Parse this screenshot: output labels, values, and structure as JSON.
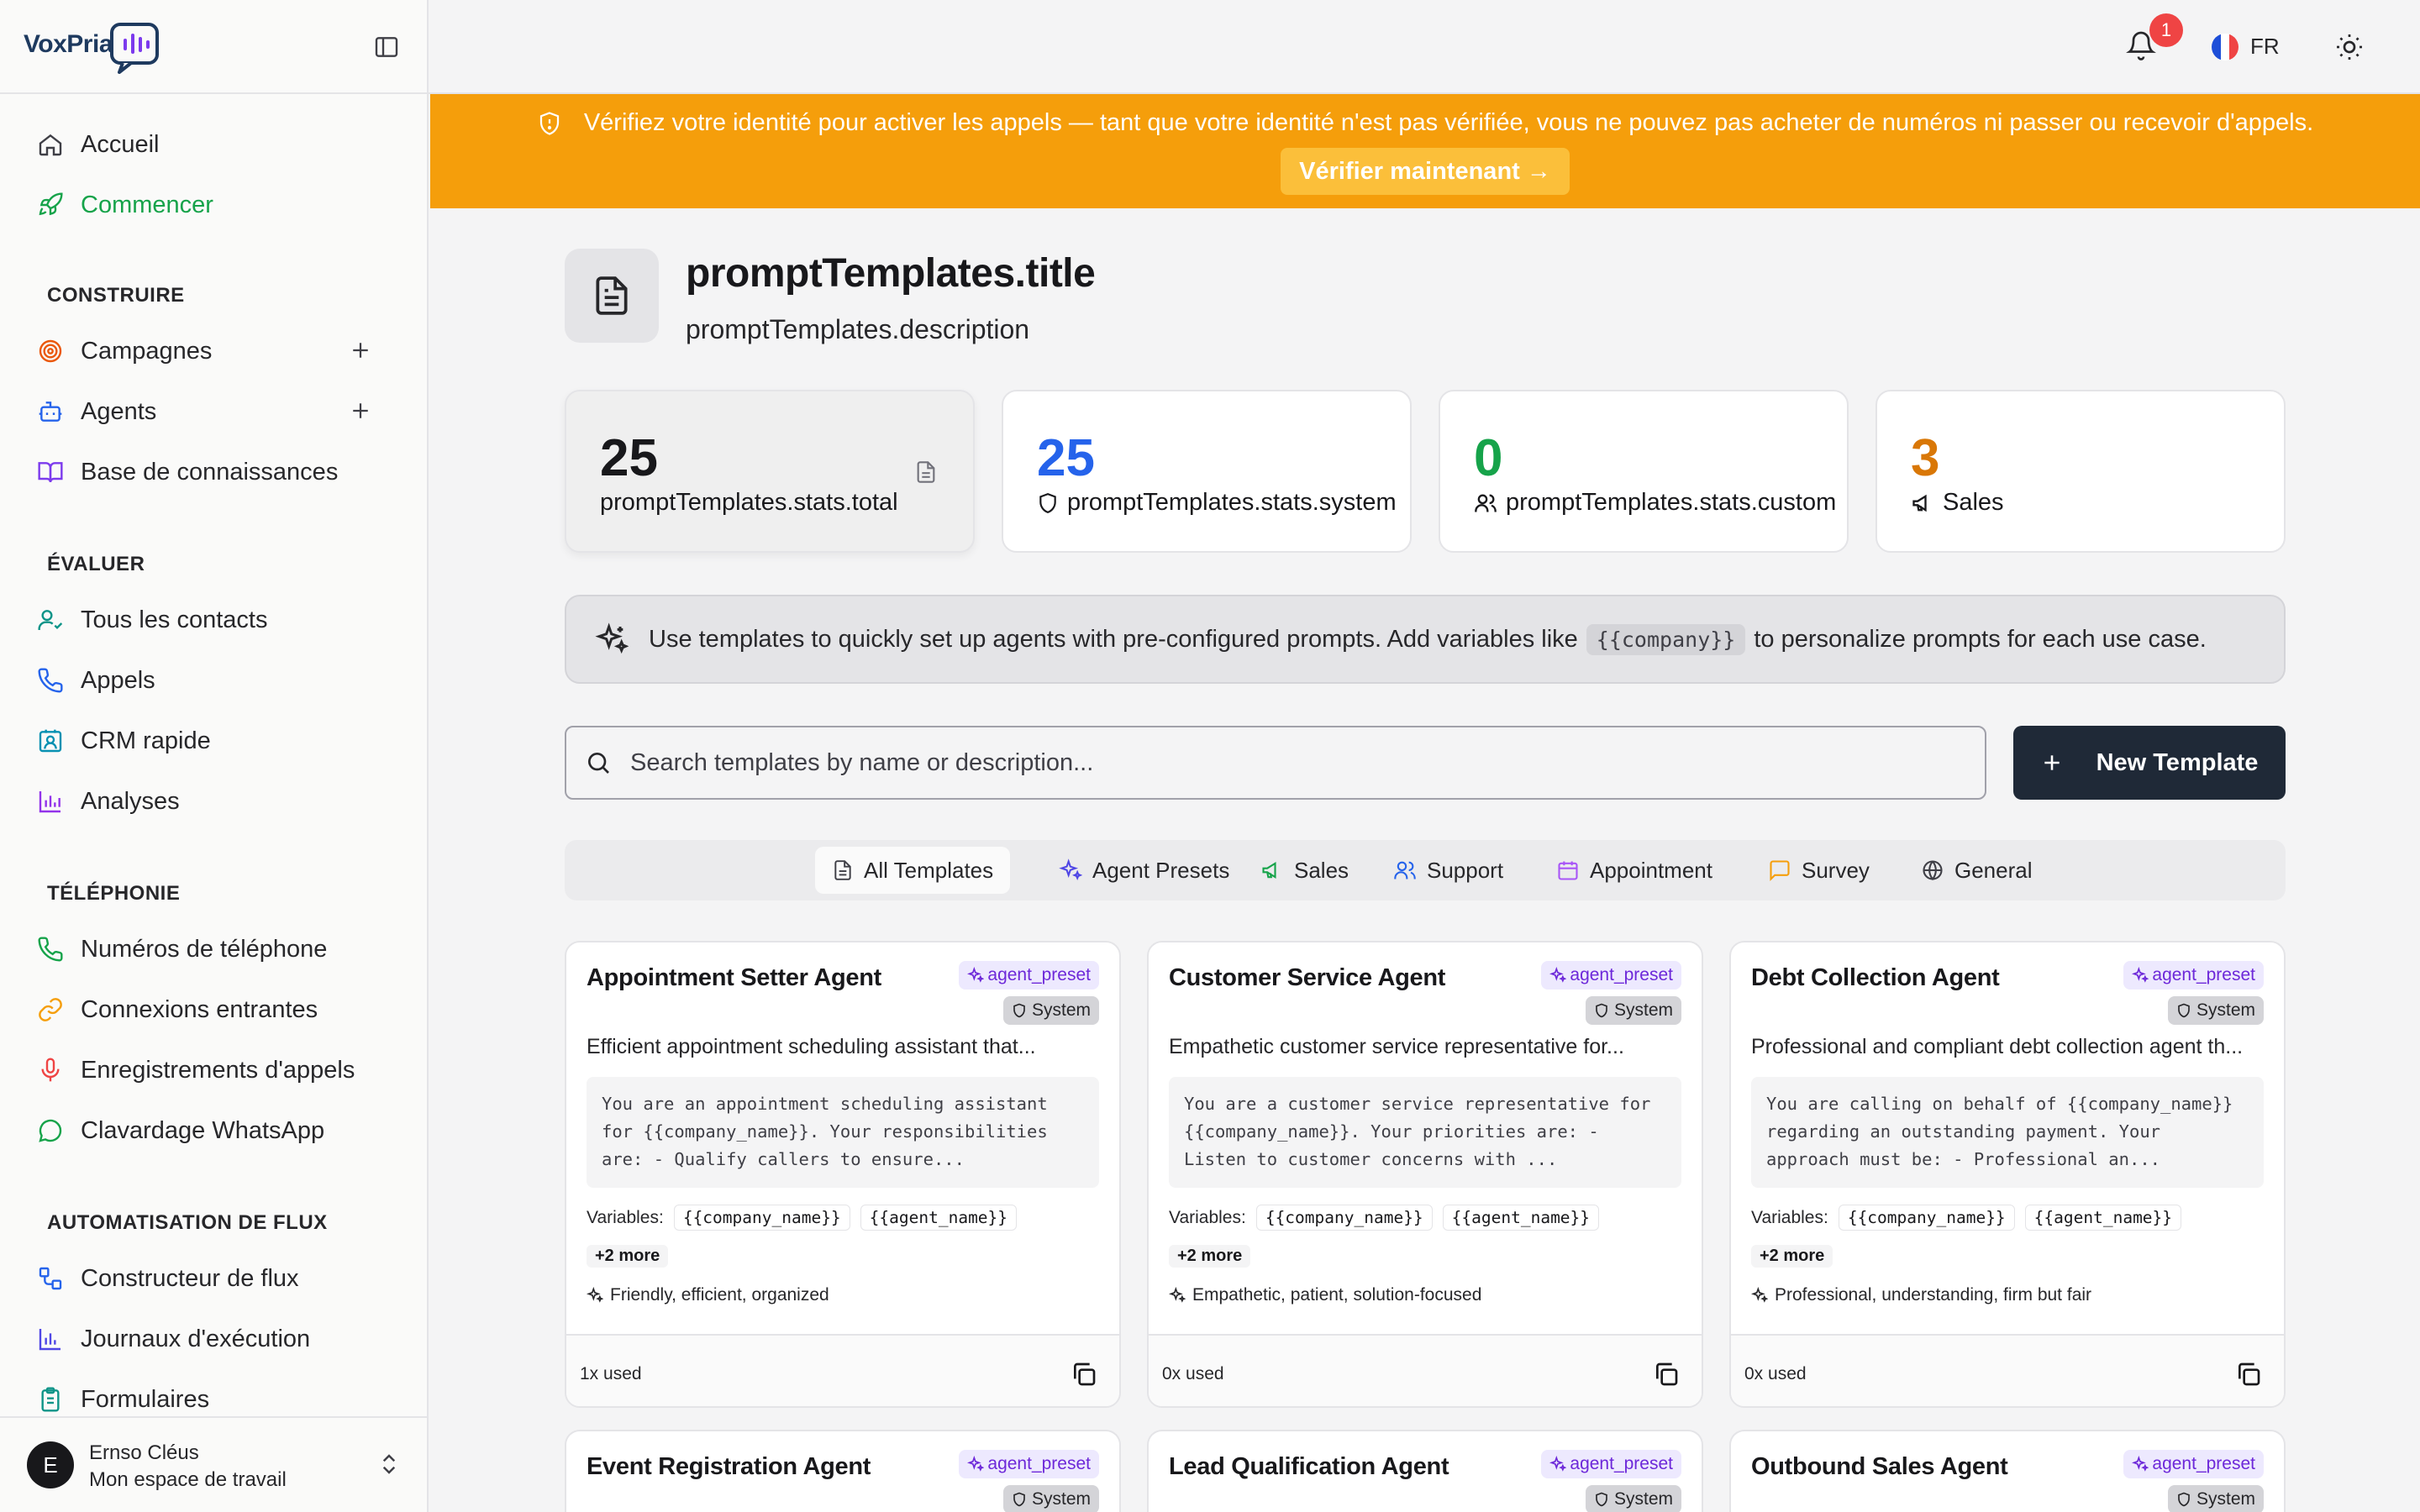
{
  "app": {
    "logo": "VoxPria"
  },
  "sidebar": {
    "items_top": [
      {
        "label": "Accueil"
      },
      {
        "label": "Commencer"
      }
    ],
    "sections": [
      {
        "title": "CONSTRUIRE",
        "items": [
          {
            "label": "Campagnes"
          },
          {
            "label": "Agents"
          },
          {
            "label": "Base de connaissances"
          }
        ]
      },
      {
        "title": "ÉVALUER",
        "items": [
          {
            "label": "Tous les contacts"
          },
          {
            "label": "Appels"
          },
          {
            "label": "CRM rapide"
          },
          {
            "label": "Analyses"
          }
        ]
      },
      {
        "title": "TÉLÉPHONIE",
        "items": [
          {
            "label": "Numéros de téléphone"
          },
          {
            "label": "Connexions entrantes"
          },
          {
            "label": "Enregistrements d'appels"
          },
          {
            "label": "Clavardage WhatsApp"
          }
        ]
      },
      {
        "title": "AUTOMATISATION DE FLUX",
        "items": [
          {
            "label": "Constructeur de flux"
          },
          {
            "label": "Journaux d'exécution"
          },
          {
            "label": "Formulaires"
          }
        ]
      }
    ],
    "user": {
      "initial": "E",
      "name": "Ernso Cléus",
      "workspace": "Mon espace de travail"
    }
  },
  "topbar": {
    "notifications": "1",
    "lang": "FR"
  },
  "banner": {
    "text": "Vérifiez votre identité pour activer les appels — tant que votre identité n'est pas vérifiée, vous ne pouvez pas acheter de numéros ni passer ou recevoir d'appels.",
    "button": "Vérifier maintenant →"
  },
  "page": {
    "title": "promptTemplates.title",
    "description": "promptTemplates.description"
  },
  "stats": [
    {
      "value": "25",
      "label": "promptTemplates.stats.total",
      "color": "#18181b"
    },
    {
      "value": "25",
      "label": "promptTemplates.stats.system",
      "color": "#2563eb"
    },
    {
      "value": "0",
      "label": "promptTemplates.stats.custom",
      "color": "#16a34a"
    },
    {
      "value": "3",
      "label": "Sales",
      "color": "#d97706"
    }
  ],
  "tip": {
    "before": "Use templates to quickly set up agents with pre-configured prompts. Add variables like",
    "code": "{{company}}",
    "after": "to personalize prompts for each use case."
  },
  "search": {
    "placeholder": "Search templates by name or description..."
  },
  "new_template": "New Template",
  "tabs": [
    {
      "label": "All Templates"
    },
    {
      "label": "Agent Presets"
    },
    {
      "label": "Sales"
    },
    {
      "label": "Support"
    },
    {
      "label": "Appointment"
    },
    {
      "label": "Survey"
    },
    {
      "label": "General"
    }
  ],
  "card_labels": {
    "preset": "agent_preset",
    "system": "System",
    "variables": "Variables:"
  },
  "cards": [
    {
      "title": "Appointment Setter Agent",
      "description": "Efficient appointment scheduling assistant that...",
      "prompt": "You are an appointment scheduling assistant for {{company_name}}. Your responsibilities are: - Qualify callers to ensure...",
      "vars": [
        "{{company_name}}",
        "{{agent_name}}"
      ],
      "more": "+2 more",
      "tone": "Friendly, efficient, organized",
      "used": "1x used"
    },
    {
      "title": "Customer Service Agent",
      "description": "Empathetic customer service representative for...",
      "prompt": "You are a customer service representative for {{company_name}}. Your priorities are: - Listen to customer concerns with ...",
      "vars": [
        "{{company_name}}",
        "{{agent_name}}"
      ],
      "more": "+2 more",
      "tone": "Empathetic, patient, solution-focused",
      "used": "0x used"
    },
    {
      "title": "Debt Collection Agent",
      "description": "Professional and compliant debt collection agent th...",
      "prompt": "You are calling on behalf of {{company_name}} regarding an outstanding payment. Your approach must be: - Professional an...",
      "vars": [
        "{{company_name}}",
        "{{agent_name}}"
      ],
      "more": "+2 more",
      "tone": "Professional, understanding, firm but fair",
      "used": "0x used"
    },
    {
      "title": "Event Registration Agent"
    },
    {
      "title": "Lead Qualification Agent"
    },
    {
      "title": "Outbound Sales Agent"
    }
  ]
}
